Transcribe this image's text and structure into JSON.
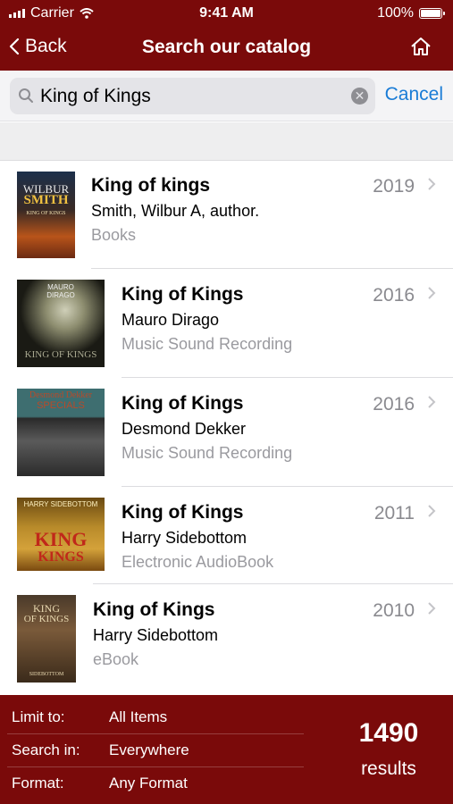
{
  "status": {
    "carrier": "Carrier",
    "time": "9:41 AM",
    "battery": "100%"
  },
  "nav": {
    "back_label": "Back",
    "title": "Search our catalog"
  },
  "search": {
    "value": "King of Kings",
    "cancel_label": "Cancel"
  },
  "results": [
    {
      "title": "King of kings",
      "author": "Smith, Wilbur A, author.",
      "format": "Books",
      "year": "2019",
      "cover_text": [
        "WILBUR",
        "SMITH",
        "KING OF KINGS"
      ]
    },
    {
      "title": "King of Kings",
      "author": "Mauro Dirago",
      "format": "Music Sound Recording",
      "year": "2016",
      "cover_text": [
        "MAURO",
        "DIRAGO",
        "KING OF KINGS"
      ]
    },
    {
      "title": "King of Kings",
      "author": "Desmond Dekker",
      "format": "Music Sound Recording",
      "year": "2016",
      "cover_text": [
        "Desmond Dekker",
        "SPECIALS"
      ]
    },
    {
      "title": "King of Kings",
      "author": "Harry Sidebottom",
      "format": "Electronic AudioBook",
      "year": "2011",
      "cover_text": [
        "HARRY SIDEBOTTOM",
        "KING",
        "KINGS"
      ]
    },
    {
      "title": "King of Kings",
      "author": "Harry Sidebottom",
      "format": "eBook",
      "year": "2010",
      "cover_text": [
        "KING",
        "OF KINGS",
        "SIDEBOTTOM"
      ]
    }
  ],
  "filters": [
    {
      "label": "Limit to:",
      "value": "All Items"
    },
    {
      "label": "Search in:",
      "value": "Everywhere"
    },
    {
      "label": "Format:",
      "value": "Any Format"
    }
  ],
  "summary": {
    "count": "1490",
    "label": "results"
  },
  "colors": {
    "brand": "#7a0a0a",
    "link": "#1a7cd6"
  }
}
